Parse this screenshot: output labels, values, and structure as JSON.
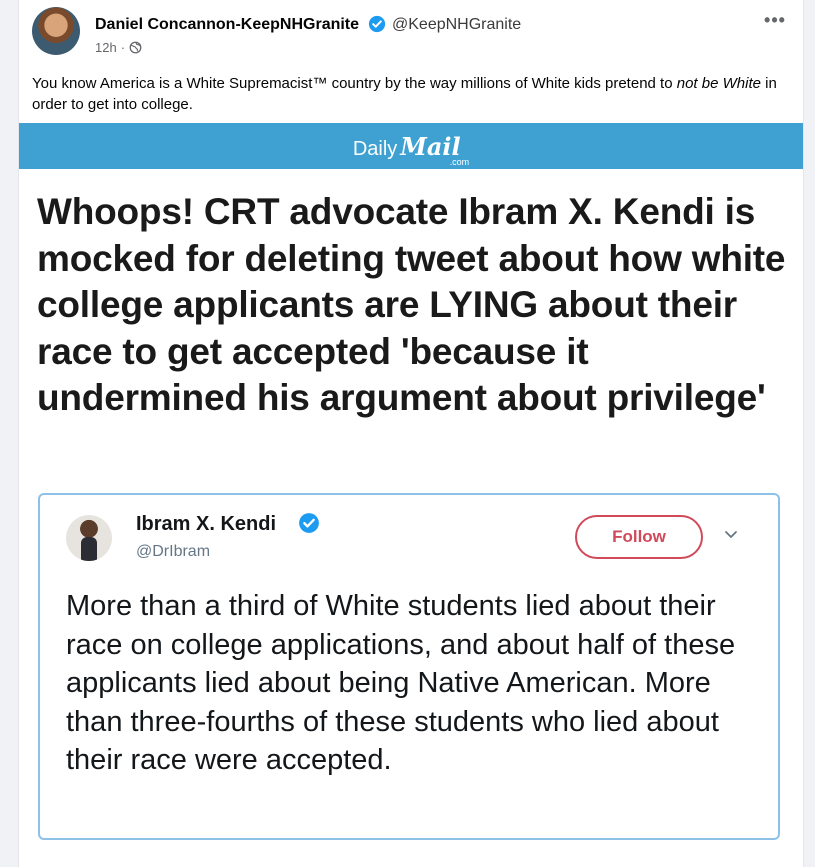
{
  "post": {
    "author": "Daniel Concannon-KeepNHGranite",
    "handle": "@KeepNHGranite",
    "time": "12h",
    "separator": "·",
    "more": "•••",
    "text_part1": "You know America is a White Supremacist™ country by the way millions of White kids pretend to ",
    "text_italic": "not be White",
    "text_part2": " in order to get into college."
  },
  "article": {
    "brand_daily": "Daily",
    "brand_mail": "Mail",
    "brand_com": ".com",
    "headline": "Whoops! CRT advocate Ibram X. Kendi is mocked for deleting tweet about how white college applicants are LYING about their race to get accepted 'because it undermined his argument about privilege'"
  },
  "tweet": {
    "name": "Ibram X. Kendi",
    "handle": "@DrIbram",
    "follow_label": "Follow",
    "body": "More than a third of White students lied about their race on college applications, and about half of these applicants lied about being Native American. More than three-fourths of these students who lied about their race were accepted."
  },
  "icons": {
    "verified": "verified-badge-icon",
    "globe": "globe-icon",
    "more": "more-options-icon",
    "chevron": "chevron-down-icon"
  },
  "colors": {
    "dailymail_blue": "#3fa1d2",
    "verified_blue": "#1d9bf0",
    "follow_red": "#d04a5a",
    "tweet_border": "#8ec1e8"
  }
}
